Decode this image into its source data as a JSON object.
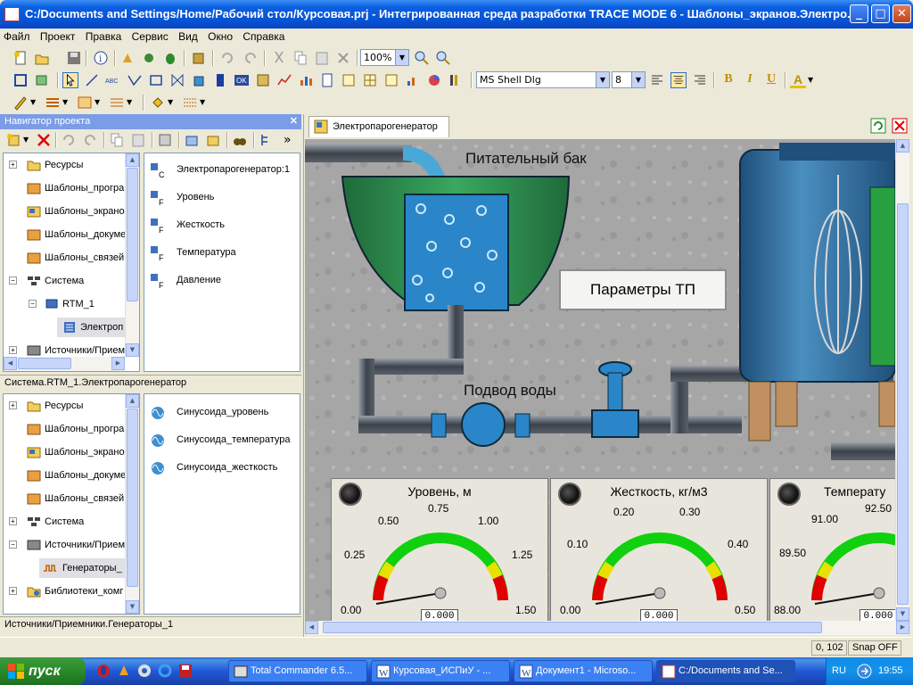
{
  "window": {
    "title": "C:/Documents and Settings/Home/Рабочий стол/Курсовая.prj - Интегрированная среда разработки TRACE MODE 6 - Шаблоны_экранов.Электро..."
  },
  "menu": [
    "Файл",
    "Проект",
    "Правка",
    "Сервис",
    "Вид",
    "Окно",
    "Справка"
  ],
  "toolbar": {
    "zoom": "100%",
    "font_name": "MS Shell Dlg",
    "font_size": "8",
    "bold": "B",
    "italic": "I",
    "underline": "U",
    "font_color": "A"
  },
  "navigator": {
    "title": "Навигатор проекта",
    "top_tree": [
      {
        "label": "Ресурсы",
        "icon": "folder-icon"
      },
      {
        "label": "Шаблоны_програ",
        "icon": "template-program-icon"
      },
      {
        "label": "Шаблоны_экрано",
        "icon": "template-screen-icon"
      },
      {
        "label": "Шаблоны_докуме",
        "icon": "template-document-icon"
      },
      {
        "label": "Шаблоны_связей",
        "icon": "template-link-icon"
      },
      {
        "label": "Система",
        "icon": "system-icon"
      },
      {
        "label": "RTM_1",
        "icon": "rtm-icon"
      },
      {
        "label": "Электроп",
        "icon": "channel-icon"
      },
      {
        "label": "Источники/Прием",
        "icon": "sources-icon"
      }
    ],
    "top_list": [
      {
        "label": "Электропарогенератор:1",
        "icon": "channel-c-icon"
      },
      {
        "label": "Уровень",
        "icon": "channel-f-icon"
      },
      {
        "label": "Жесткость",
        "icon": "channel-f-icon"
      },
      {
        "label": "Температура",
        "icon": "channel-f-icon"
      },
      {
        "label": "Давление",
        "icon": "channel-f-icon"
      }
    ],
    "path_top": "Система.RTM_1.Электропарогенератор",
    "bottom_tree": [
      {
        "label": "Ресурсы",
        "icon": "folder-icon"
      },
      {
        "label": "Шаблоны_програ",
        "icon": "template-program-icon"
      },
      {
        "label": "Шаблоны_экрано",
        "icon": "template-screen-icon"
      },
      {
        "label": "Шаблоны_докуме",
        "icon": "template-document-icon"
      },
      {
        "label": "Шаблоны_связей",
        "icon": "template-link-icon"
      },
      {
        "label": "Система",
        "icon": "system-icon"
      },
      {
        "label": "Источники/Прием",
        "icon": "sources-icon"
      },
      {
        "label": "Генераторы_",
        "icon": "generator-icon"
      },
      {
        "label": "Библиотеки_комг",
        "icon": "library-icon"
      }
    ],
    "bottom_list": [
      {
        "label": "Синусоида_уровень",
        "icon": "sine-icon"
      },
      {
        "label": "Синусоида_температура",
        "icon": "sine-icon"
      },
      {
        "label": "Синусоида_жесткость",
        "icon": "sine-icon"
      }
    ],
    "path_bottom": "Источники/Приемники.Генераторы_1"
  },
  "document": {
    "tab": "Электропарогенератор",
    "scene": {
      "tank_label": "Питательный бак",
      "water_label": "Подвод воды",
      "params_button": "Параметры ТП"
    },
    "gauges": [
      {
        "title": "Уровень, м",
        "ticks": [
          "0.00",
          "0.25",
          "0.50",
          "0.75",
          "1.00",
          "1.25",
          "1.50"
        ],
        "readout": "0.000"
      },
      {
        "title": "Жесткость, кг/м3",
        "ticks": [
          "0.00",
          "0.10",
          "0.20",
          "0.30",
          "0.40",
          "0.50"
        ],
        "readout": "0.000"
      },
      {
        "title": "Температу",
        "ticks": [
          "88.00",
          "89.50",
          "91.00",
          "92.50"
        ],
        "readout": "0.000"
      }
    ]
  },
  "status": {
    "coords": "0, 102",
    "snap": "Snap OFF"
  },
  "taskbar": {
    "start": "пуск",
    "tasks": [
      {
        "label": "Total Commander 6.5..."
      },
      {
        "label": "Курсовая_ИСПиУ - ..."
      },
      {
        "label": "Документ1 - Microso..."
      },
      {
        "label": "C:/Documents and Se..."
      }
    ],
    "lang": "RU",
    "clock": "19:55"
  }
}
